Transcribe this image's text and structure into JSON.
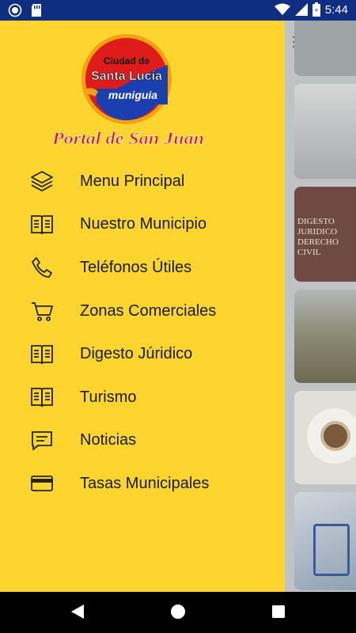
{
  "status_bar": {
    "time": "5:44",
    "icons": [
      "record-icon",
      "sd-card-icon",
      "wifi-icon",
      "signal-icon",
      "battery-icon"
    ]
  },
  "drawer": {
    "logo": {
      "line1": "Ciudad de",
      "line2": "Santa Lucía",
      "line3": "muniguia",
      "subtitle": "Portal de San Juan"
    },
    "items": [
      {
        "label": "Menu Principal",
        "icon": "layers-icon"
      },
      {
        "label": "Nuestro Municipio",
        "icon": "book-icon"
      },
      {
        "label": "Teléfonos Útiles",
        "icon": "phone-icon"
      },
      {
        "label": "Zonas Comerciales",
        "icon": "cart-icon"
      },
      {
        "label": "Digesto Júridico",
        "icon": "book-icon"
      },
      {
        "label": "Turismo",
        "icon": "book-icon"
      },
      {
        "label": "Noticias",
        "icon": "chat-icon"
      },
      {
        "label": "Tasas Municipales",
        "icon": "card-icon"
      }
    ]
  },
  "background": {
    "card_sign_text": [
      "DIGESTO",
      "JURIDICO",
      "DERECHO",
      "CIVIL"
    ]
  },
  "colors": {
    "drawer_bg": "#fdd52e",
    "status_bar": "#0f2e82",
    "logo_red": "#e01b1b",
    "logo_blue": "#1b3fb0"
  }
}
